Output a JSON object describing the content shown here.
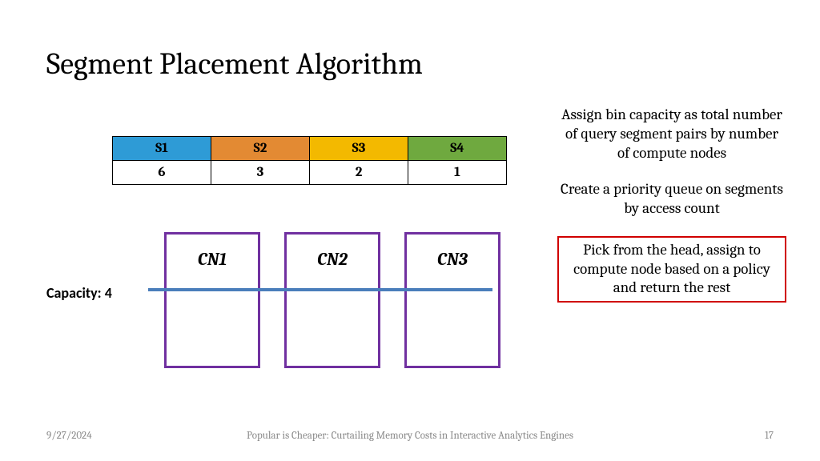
{
  "title": "Segment Placement Algorithm",
  "segments": {
    "headers": [
      "S1",
      "S2",
      "S3",
      "S4"
    ],
    "values": [
      "6",
      "3",
      "2",
      "1"
    ]
  },
  "capacity_label": "Capacity: 4",
  "compute_nodes": [
    "CN1",
    "CN2",
    "CN3"
  ],
  "steps": {
    "p1": "Assign bin capacity as total number of query segment pairs by number of compute nodes",
    "p2": "Create a priority queue on segments by access count",
    "p3": "Pick from the head, assign to compute node based on a policy and return the rest"
  },
  "footer": {
    "date": "9/27/2024",
    "title": "Popular is Cheaper: Curtailing Memory Costs in Interactive Analytics Engines",
    "page": "17"
  }
}
